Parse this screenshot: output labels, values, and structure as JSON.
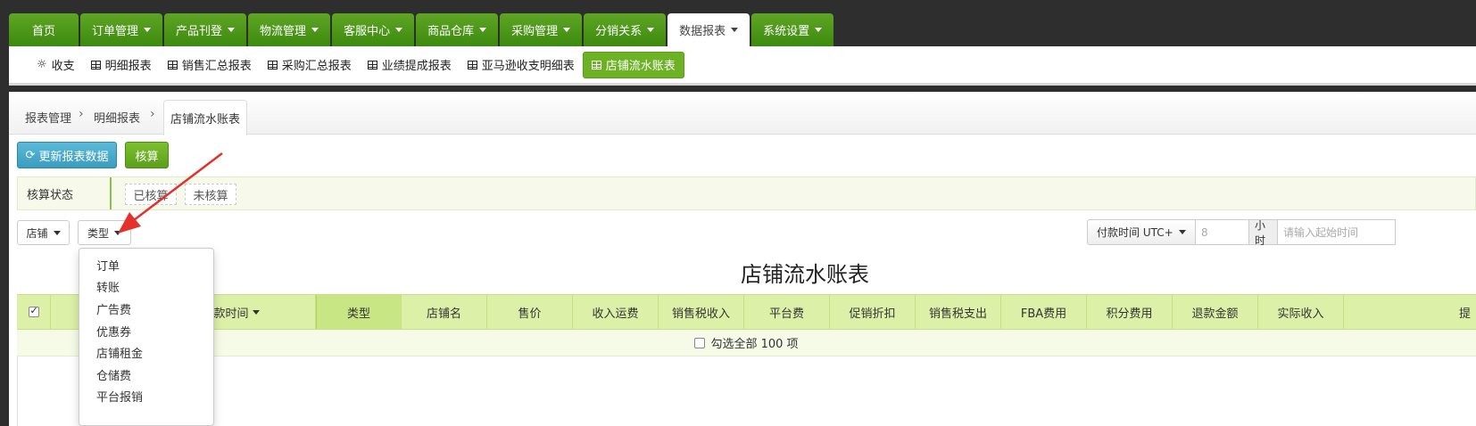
{
  "topnav": {
    "items": [
      {
        "label": "首页",
        "caret": false
      },
      {
        "label": "订单管理",
        "caret": true
      },
      {
        "label": "产品刊登",
        "caret": true
      },
      {
        "label": "物流管理",
        "caret": true
      },
      {
        "label": "客服中心",
        "caret": true
      },
      {
        "label": "商品仓库",
        "caret": true
      },
      {
        "label": "采购管理",
        "caret": true
      },
      {
        "label": "分销关系",
        "caret": true
      },
      {
        "label": "数据报表",
        "caret": true,
        "active": true
      },
      {
        "label": "系统设置",
        "caret": true
      }
    ]
  },
  "subnav": {
    "items": [
      {
        "label": "收支",
        "icon": "gear-icon"
      },
      {
        "label": "明细报表",
        "icon": "table-icon"
      },
      {
        "label": "销售汇总报表",
        "icon": "table-icon"
      },
      {
        "label": "采购汇总报表",
        "icon": "table-icon"
      },
      {
        "label": "业绩提成报表",
        "icon": "table-icon"
      },
      {
        "label": "亚马逊收支明细表",
        "icon": "table-icon"
      },
      {
        "label": "店铺流水账表",
        "icon": "table-icon",
        "active": true
      }
    ]
  },
  "breadcrumb": {
    "item1": "报表管理",
    "item2": "明细报表",
    "current": "店铺流水账表",
    "separator": "›"
  },
  "toolbar": {
    "refresh_label": "更新报表数据",
    "calc_label": "核算"
  },
  "status": {
    "label": "核算状态",
    "options": [
      "已核算",
      "未核算"
    ]
  },
  "filters": {
    "store_label": "店铺",
    "type_label": "类型"
  },
  "time_filter": {
    "button_label": "付款时间 UTC+",
    "offset_value": "8",
    "unit": "小时",
    "start_placeholder": "请输入起始时间"
  },
  "report": {
    "title": "店铺流水账表"
  },
  "table": {
    "columns": [
      "付款时间",
      "类型",
      "店铺名",
      "售价",
      "收入运费",
      "销售税收入",
      "平台费",
      "促销折扣",
      "销售税支出",
      "FBA费用",
      "积分费用",
      "退款金额",
      "实际收入",
      "提"
    ],
    "select_all_label": "勾选全部 100 项"
  },
  "type_dropdown": {
    "options": [
      "订单",
      "转账",
      "广告费",
      "优惠券",
      "店铺租金",
      "仓储费",
      "平台报销"
    ]
  },
  "colors": {
    "nav_green": "#4a9a18",
    "accent_green": "#6cb224",
    "header_green": "#dcf0a8",
    "refresh_blue": "#3a9cc0",
    "arrow_red": "#e3322b"
  }
}
